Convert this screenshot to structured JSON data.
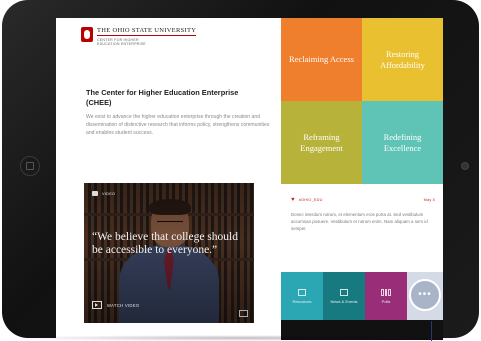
{
  "header": {
    "university": "THE OHIO STATE UNIVERSITY",
    "center_line1": "CENTER FOR HIGHER",
    "center_line2": "EDUCATION ENTERPRISE"
  },
  "intro": {
    "title": "The Center for Higher Education Enterprise (CHEE)",
    "body": "We exist to advance the higher education enterprise through the creation and dissemination of distinctive research that informs policy, strengthens communities and enables student success."
  },
  "video": {
    "badge": "VIDEO",
    "quote": "“We believe that college should be accessible to everyone.”",
    "watch_label": "WATCH VIDEO"
  },
  "tiles": [
    {
      "label": "Reclaiming Access",
      "color": "#ef7f2d"
    },
    {
      "label": "Restoring Affordability",
      "color": "#e9c02f"
    },
    {
      "label": "Reframing Engagement",
      "color": "#b7b33a"
    },
    {
      "label": "Redefining Excellence",
      "color": "#5fc4b5"
    }
  ],
  "news": {
    "handle": "#OHIO_EDU",
    "time": "May 5",
    "body": "Donec interdum rutrum, et elementum eros porta at. Sed vestibulum accumsan posuere. Vestibulum et rutrum enim. Nam aliquam a sem id semper."
  },
  "nav": {
    "resources": "Resources",
    "news_events": "News & Events",
    "polls": "Polls",
    "more": "•••"
  }
}
